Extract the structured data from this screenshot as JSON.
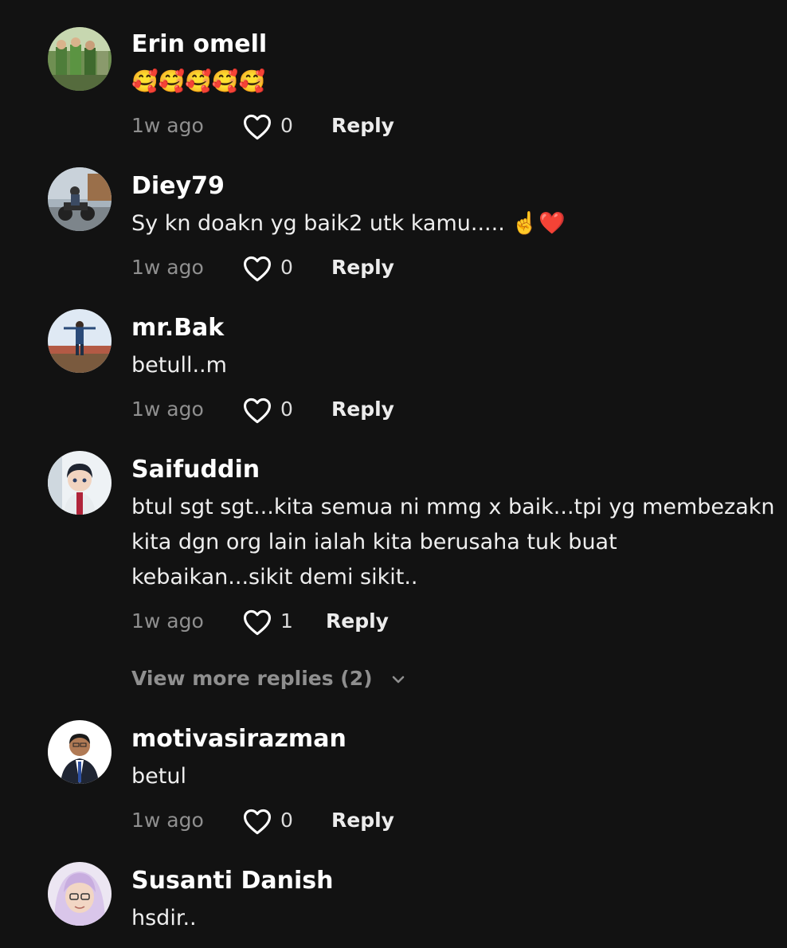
{
  "comments": [
    {
      "username": "Erin omell",
      "text": "🥰🥰🥰🥰🥰",
      "timestamp": "1w ago",
      "likes": "0",
      "reply_label": "Reply"
    },
    {
      "username": "Diey79",
      "text": "Sy kn doakn yg baik2 utk kamu..... ☝️❤️",
      "timestamp": "1w ago",
      "likes": "0",
      "reply_label": "Reply"
    },
    {
      "username": "mr.Bak",
      "text": "betull..m",
      "timestamp": "1w ago",
      "likes": "0",
      "reply_label": "Reply"
    },
    {
      "username": "Saifuddin",
      "text": "btul sgt sgt...kita semua ni mmg x baik...tpi yg membezakn kita dgn org lain ialah kita berusaha tuk buat kebaikan...sikit demi sikit..",
      "timestamp": "1w ago",
      "likes": "1",
      "reply_label": "Reply",
      "view_more_replies": "View more replies (2)"
    },
    {
      "username": "motivasirazman",
      "text": "betul",
      "timestamp": "1w ago",
      "likes": "0",
      "reply_label": "Reply"
    },
    {
      "username": "Susanti Danish",
      "text": "hsdir..",
      "timestamp": "",
      "likes": "",
      "reply_label": ""
    }
  ],
  "icons": {
    "like": "heart-outline-icon",
    "expand": "chevron-down-icon"
  },
  "colors": {
    "background": "#121212",
    "username": "#ffffff",
    "secondary_text": "#8f8f8f"
  }
}
